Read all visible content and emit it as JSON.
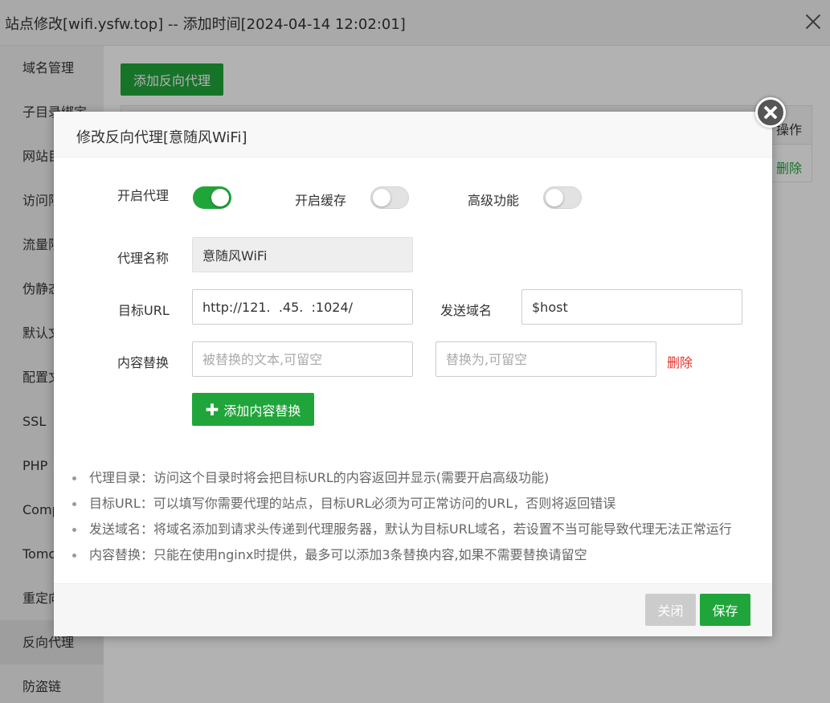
{
  "window": {
    "title": "站点修改[wifi.ysfw.top] -- 添加时间[2024-04-14 12:02:01]"
  },
  "sidebar": {
    "items": [
      {
        "label": "域名管理"
      },
      {
        "label": "子目录绑定"
      },
      {
        "label": "网站目录"
      },
      {
        "label": "访问限制"
      },
      {
        "label": "流量限制"
      },
      {
        "label": "伪静态"
      },
      {
        "label": "默认文档"
      },
      {
        "label": "配置文件"
      },
      {
        "label": "SSL"
      },
      {
        "label": "PHP"
      },
      {
        "label": "Composer"
      },
      {
        "label": "Tomcat"
      },
      {
        "label": "重定向"
      },
      {
        "label": "反向代理"
      },
      {
        "label": "防盗链"
      }
    ],
    "active": "反向代理"
  },
  "main": {
    "add_button": "添加反向代理",
    "table": {
      "op_header": "操作",
      "delete": "删除"
    }
  },
  "modal": {
    "title": "修改反向代理[意随风WiFi]",
    "toggles": {
      "proxy": {
        "label": "开启代理",
        "on": true
      },
      "cache": {
        "label": "开启缓存",
        "on": false
      },
      "advanced": {
        "label": "高级功能",
        "on": false
      }
    },
    "proxy_name": {
      "label": "代理名称",
      "value": "意随风WiFi"
    },
    "target_url": {
      "label": "目标URL",
      "value": "http://121.  .45.  :1024/"
    },
    "send_domain": {
      "label": "发送域名",
      "value": "$host"
    },
    "content_replace": {
      "label": "内容替换",
      "from_placeholder": "被替换的文本,可留空",
      "to_placeholder": "替换为,可留空",
      "delete": "删除",
      "add_button": "添加内容替换"
    },
    "tips": [
      "代理目录：访问这个目录时将会把目标URL的内容返回并显示(需要开启高级功能)",
      "目标URL：可以填写你需要代理的站点，目标URL必须为可正常访问的URL，否则将返回错误",
      "发送域名：将域名添加到请求头传递到代理服务器，默认为目标URL域名，若设置不当可能导致代理无法正常运行",
      "内容替换：只能在使用nginx时提供，最多可以添加3条替换内容,如果不需要替换请留空"
    ],
    "footer": {
      "close": "关闭",
      "save": "保存"
    }
  },
  "colors": {
    "accent": "#20a53a",
    "danger": "#e0312a",
    "disabled": "#cccccc"
  }
}
